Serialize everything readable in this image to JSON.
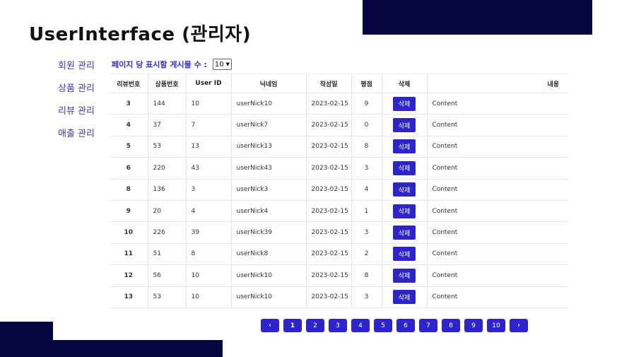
{
  "title": "UserInterface (관리자)",
  "sidebar": {
    "items": [
      {
        "label": "회원 관리"
      },
      {
        "label": "상품 관리"
      },
      {
        "label": "리뷰 관리"
      },
      {
        "label": "매출 관리"
      }
    ]
  },
  "per_page": {
    "label": "페이지 당 표시할 게시물 수 :",
    "value": "10"
  },
  "table": {
    "headers": [
      "리뷰번호",
      "상품번호",
      "User ID",
      "닉네임",
      "작성일",
      "평점",
      "삭제",
      "내용"
    ],
    "delete_label": "삭제",
    "rows": [
      {
        "review_no": "3",
        "product_no": "144",
        "user_id": "10",
        "nickname": "userNick10",
        "date": "2023-02-15",
        "rating": "9",
        "content": "Content"
      },
      {
        "review_no": "4",
        "product_no": "37",
        "user_id": "7",
        "nickname": "userNick7",
        "date": "2023-02-15",
        "rating": "0",
        "content": "Content"
      },
      {
        "review_no": "5",
        "product_no": "53",
        "user_id": "13",
        "nickname": "userNick13",
        "date": "2023-02-15",
        "rating": "8",
        "content": "Content"
      },
      {
        "review_no": "6",
        "product_no": "220",
        "user_id": "43",
        "nickname": "userNick43",
        "date": "2023-02-15",
        "rating": "3",
        "content": "Content"
      },
      {
        "review_no": "8",
        "product_no": "136",
        "user_id": "3",
        "nickname": "userNick3",
        "date": "2023-02-15",
        "rating": "4",
        "content": "Content"
      },
      {
        "review_no": "9",
        "product_no": "20",
        "user_id": "4",
        "nickname": "userNick4",
        "date": "2023-02-15",
        "rating": "1",
        "content": "Content"
      },
      {
        "review_no": "10",
        "product_no": "226",
        "user_id": "39",
        "nickname": "userNick39",
        "date": "2023-02-15",
        "rating": "3",
        "content": "Content"
      },
      {
        "review_no": "11",
        "product_no": "51",
        "user_id": "8",
        "nickname": "userNick8",
        "date": "2023-02-15",
        "rating": "2",
        "content": "Content"
      },
      {
        "review_no": "12",
        "product_no": "56",
        "user_id": "10",
        "nickname": "userNick10",
        "date": "2023-02-15",
        "rating": "8",
        "content": "Content"
      },
      {
        "review_no": "13",
        "product_no": "53",
        "user_id": "10",
        "nickname": "userNick10",
        "date": "2023-02-15",
        "rating": "3",
        "content": "Content"
      }
    ]
  },
  "pagination": {
    "prev_icon": "chevron-left-icon",
    "next_icon": "chevron-right-icon",
    "prev_glyph": "‹",
    "next_glyph": "›",
    "pages": [
      "1",
      "2",
      "3",
      "4",
      "5",
      "6",
      "7",
      "8",
      "9",
      "10"
    ],
    "current": "1"
  },
  "colors": {
    "accent": "#2e25c9",
    "deco_navy": "#05053f",
    "sidebar_text": "#3c3cb4"
  }
}
